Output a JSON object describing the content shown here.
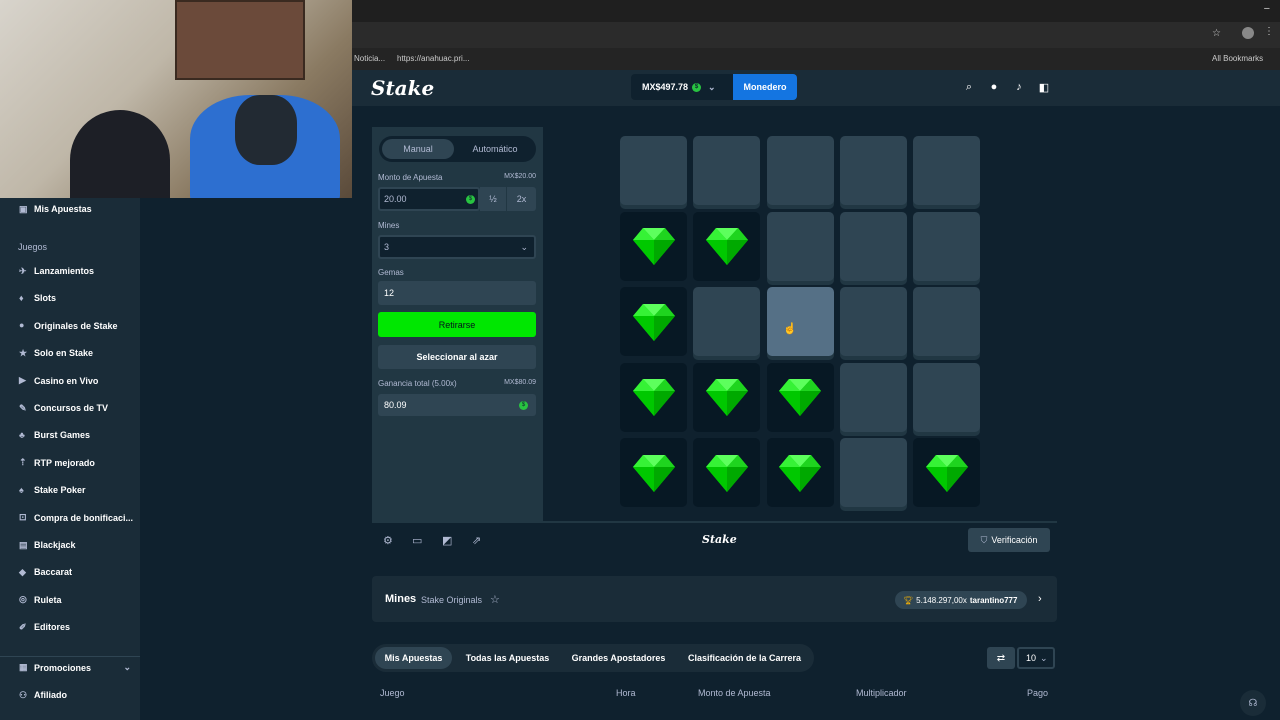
{
  "browser": {
    "bookmark_1": "Noticia...",
    "bookmark_2": "https://anahuac.pri...",
    "all_bookmarks": "All Bookmarks"
  },
  "sidebar": {
    "my_bets": "Mis Apuestas",
    "games_header": "Juegos",
    "items": [
      {
        "label": "Lanzamientos",
        "icon": "rocket-icon"
      },
      {
        "label": "Slots",
        "icon": "slots-icon"
      },
      {
        "label": "Originales de Stake",
        "icon": "stake-originals-icon"
      },
      {
        "label": "Solo en Stake",
        "icon": "exclusive-icon"
      },
      {
        "label": "Casino en Vivo",
        "icon": "live-casino-icon"
      },
      {
        "label": "Concursos de TV",
        "icon": "tv-icon"
      },
      {
        "label": "Burst Games",
        "icon": "burst-icon"
      },
      {
        "label": "RTP mejorado",
        "icon": "rtp-icon"
      },
      {
        "label": "Stake Poker",
        "icon": "poker-icon"
      },
      {
        "label": "Compra de bonificaci...",
        "icon": "bonus-buy-icon"
      },
      {
        "label": "Blackjack",
        "icon": "blackjack-icon"
      },
      {
        "label": "Baccarat",
        "icon": "baccarat-icon"
      },
      {
        "label": "Ruleta",
        "icon": "roulette-icon"
      },
      {
        "label": "Editores",
        "icon": "publishers-icon"
      }
    ],
    "promotions": "Promociones",
    "affiliate": "Afiliado"
  },
  "header": {
    "logo": "Stake",
    "balance": "MX$497.78",
    "wallet": "Monedero"
  },
  "controls": {
    "tab_manual": "Manual",
    "tab_auto": "Automático",
    "bet_label": "Monto de Apuesta",
    "bet_currency_value": "MX$20.00",
    "bet_value": "20.00",
    "half": "½",
    "double": "2x",
    "mines_label": "Mines",
    "mines_value": "3",
    "gems_label": "Gemas",
    "gems_value": "12",
    "cashout": "Retirarse",
    "random": "Seleccionar al azar",
    "profit_label": "Ganancia total (5.00x)",
    "profit_currency_value": "MX$80.09",
    "profit_value": "80.09"
  },
  "board": {
    "rows": [
      [
        "hidden",
        "hidden",
        "hidden",
        "hidden",
        "hidden"
      ],
      [
        "gem",
        "gem",
        "hidden",
        "hidden",
        "hidden"
      ],
      [
        "gem",
        "hidden",
        "hover",
        "hidden",
        "hidden"
      ],
      [
        "gem",
        "gem",
        "gem",
        "hidden",
        "hidden"
      ],
      [
        "gem",
        "gem",
        "gem",
        "hidden",
        "gem"
      ]
    ],
    "gem_color": "#00e701"
  },
  "footer": {
    "logo": "Stake",
    "verify": "Verificación"
  },
  "game_info": {
    "title": "Mines",
    "subtitle": "Stake Originals",
    "record": "5.148.297,00x",
    "record_user": "tarantino777"
  },
  "bets": {
    "tabs": [
      "Mis Apuestas",
      "Todas las Apuestas",
      "Grandes Apostadores",
      "Clasificación de la Carrera"
    ],
    "page_size": "10",
    "columns": [
      "Juego",
      "Hora",
      "Monto de Apuesta",
      "Multiplicador",
      "Pago"
    ]
  }
}
